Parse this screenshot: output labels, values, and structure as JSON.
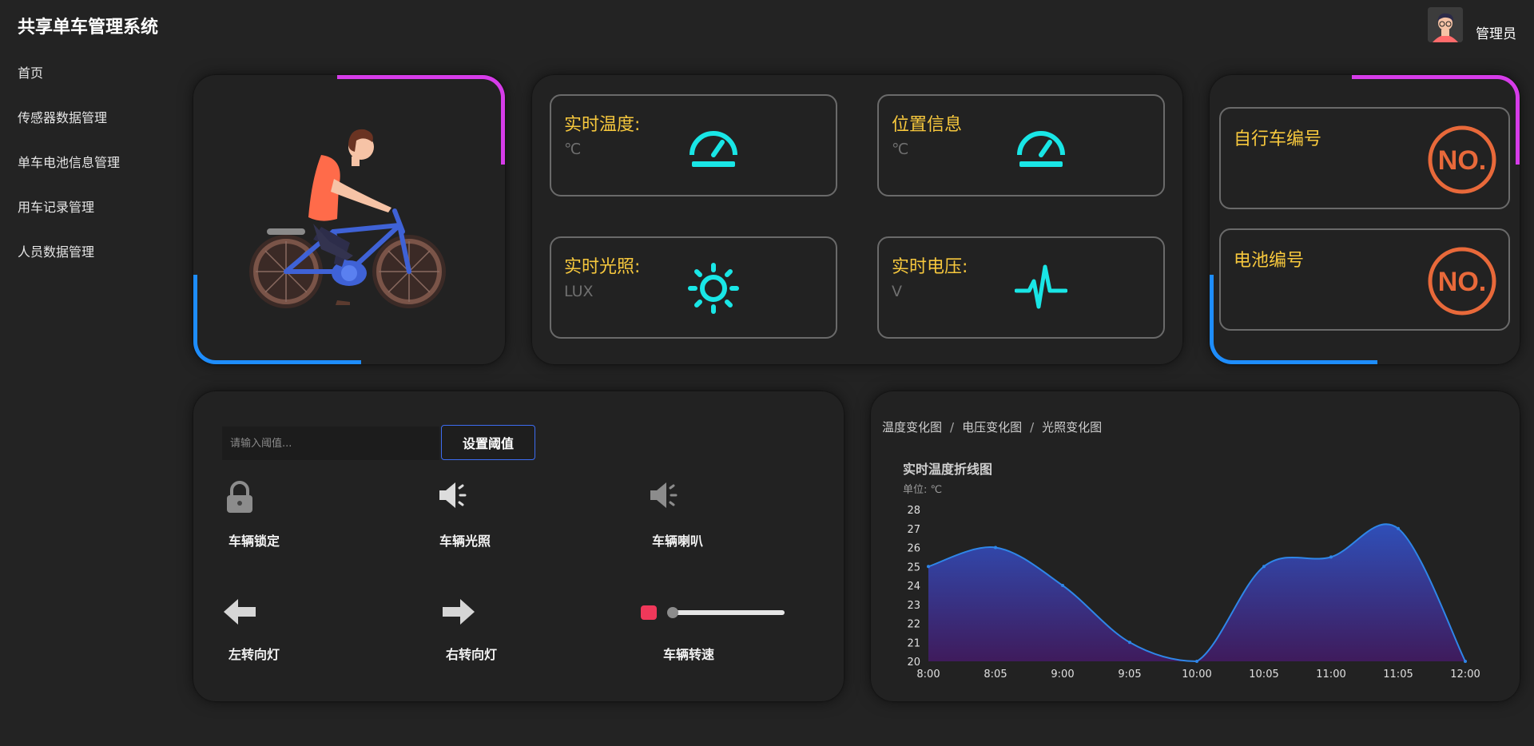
{
  "app": {
    "title": "共享单车管理系统"
  },
  "user": {
    "name": "管理员"
  },
  "sidebar": {
    "items": [
      {
        "label": "首页"
      },
      {
        "label": "传感器数据管理"
      },
      {
        "label": "单车电池信息管理"
      },
      {
        "label": "用车记录管理"
      },
      {
        "label": "人员数据管理"
      }
    ]
  },
  "sensors": [
    {
      "label": "实时温度:",
      "unit": "℃",
      "icon": "gauge-icon"
    },
    {
      "label": "位置信息",
      "unit": "℃",
      "icon": "gauge-icon"
    },
    {
      "label": "实时光照:",
      "unit": "LUX",
      "icon": "sun-icon"
    },
    {
      "label": "实时电压:",
      "unit": "V",
      "icon": "pulse-icon"
    }
  ],
  "ids": [
    {
      "label": "自行车编号",
      "icon": "no-icon"
    },
    {
      "label": "电池编号",
      "icon": "no-icon"
    }
  ],
  "controls": {
    "threshold_placeholder": "请输入阈值...",
    "threshold_button": "设置阈值",
    "lock_label": "车辆锁定",
    "light_label": "车辆光照",
    "horn_label": "车辆喇叭",
    "left_label": "左转向灯",
    "right_label": "右转向灯",
    "speed_label": "车辆转速",
    "speed_level": 0
  },
  "chart": {
    "tabs": [
      "温度变化图",
      "电压变化图",
      "光照变化图"
    ],
    "separator": "/",
    "title": "实时温度折线图",
    "unit": "单位: ℃"
  },
  "colors": {
    "accent_yellow": "#f7c83d",
    "icon_cyan": "#19e6e6",
    "no_orange": "#e8693a",
    "corner_pink": "#d63ce9",
    "corner_blue": "#1e8dfc"
  },
  "chart_data": {
    "type": "area",
    "title": "实时温度折线图",
    "ylabel": "单位: ℃",
    "x": [
      "8:00",
      "8:05",
      "9:00",
      "9:05",
      "10:00",
      "10:05",
      "11:00",
      "11:05",
      "12:00"
    ],
    "values": [
      25,
      26,
      24,
      21,
      20,
      25,
      25.5,
      27,
      20
    ],
    "ylim": [
      20,
      28
    ],
    "yticks": [
      20,
      21,
      22,
      23,
      24,
      25,
      26,
      27,
      28
    ],
    "grid": false
  }
}
